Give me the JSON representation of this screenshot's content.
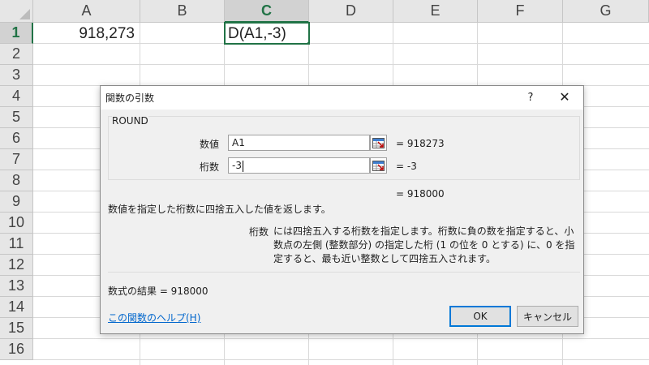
{
  "sheet": {
    "columns": [
      "A",
      "B",
      "C",
      "D",
      "E",
      "F",
      "G"
    ],
    "rows": [
      "1",
      "2",
      "3",
      "4",
      "5",
      "6",
      "7",
      "8",
      "9",
      "10",
      "11",
      "12",
      "13",
      "14",
      "15",
      "16"
    ],
    "cells": {
      "A1": "918,273",
      "C1": "D(A1,-3)"
    },
    "active_cell": "C1",
    "accent_color": "#217346"
  },
  "dialog": {
    "title": "関数の引数",
    "help_glyph": "?",
    "close_glyph": "✕",
    "function_name": "ROUND",
    "args": [
      {
        "label": "数値",
        "value": "A1",
        "result": "=  918273"
      },
      {
        "label": "桁数",
        "value": "-3",
        "result": "=  -3"
      }
    ],
    "overall_result": "=  918000",
    "description": "数値を指定した桁数に四捨五入した値を返します。",
    "param_name": "桁数",
    "param_description": "には四捨五入する桁数を指定します。桁数に負の数を指定すると、小数点の左側 (整数部分) の指定した桁 (1 の位を 0 とする) に、0 を指定すると、最も近い整数として四捨五入されます。",
    "formula_result": "数式の結果 =  918000",
    "help_link": "この関数のヘルプ(H)",
    "ok_label": "OK",
    "cancel_label": "キャンセル",
    "icons": {
      "ref": "collapse-dialog-icon",
      "close": "close-icon",
      "help": "help-icon"
    }
  }
}
